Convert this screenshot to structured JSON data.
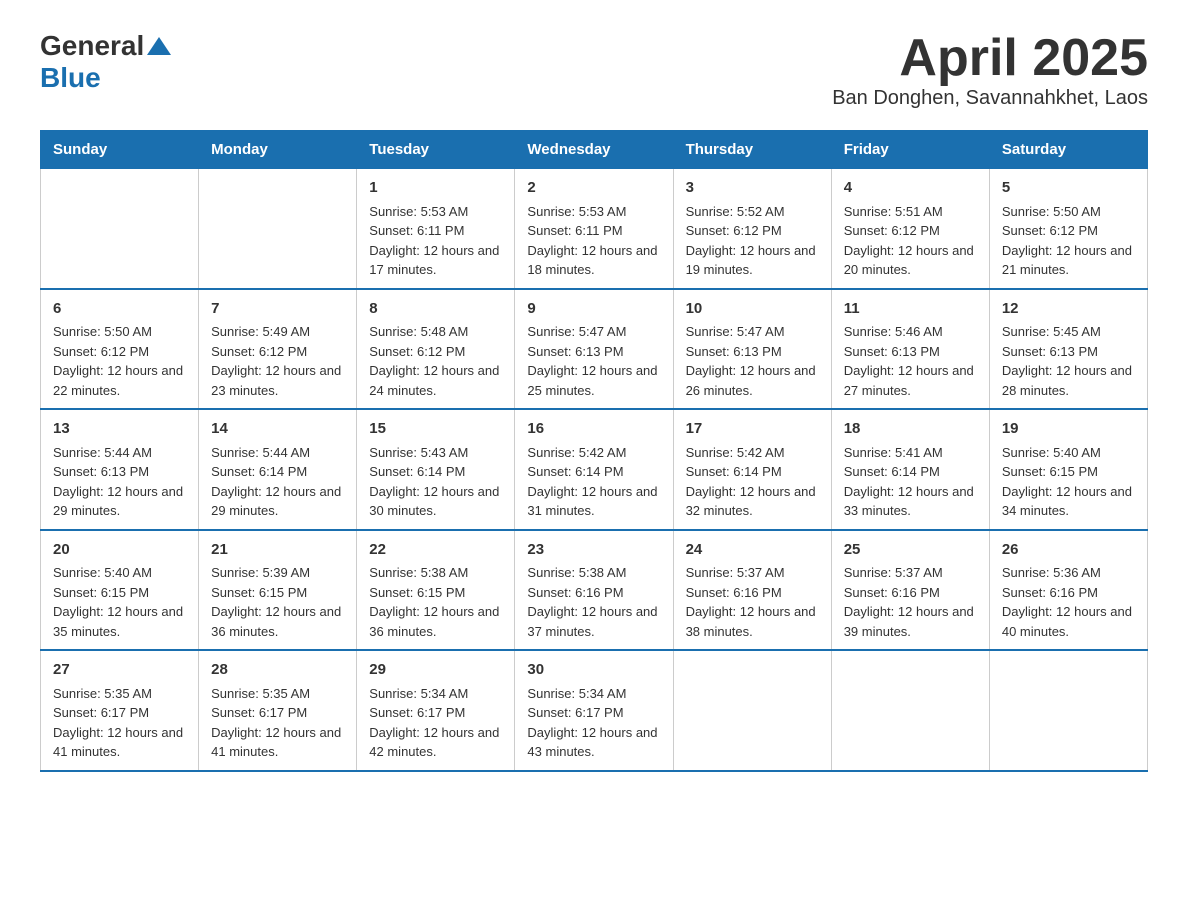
{
  "header": {
    "logo_general": "General",
    "logo_blue": "Blue",
    "title": "April 2025",
    "subtitle": "Ban Donghen, Savannahkhet, Laos"
  },
  "calendar": {
    "days_of_week": [
      "Sunday",
      "Monday",
      "Tuesday",
      "Wednesday",
      "Thursday",
      "Friday",
      "Saturday"
    ],
    "weeks": [
      [
        {
          "day": "",
          "info": ""
        },
        {
          "day": "",
          "info": ""
        },
        {
          "day": "1",
          "info": "Sunrise: 5:53 AM\nSunset: 6:11 PM\nDaylight: 12 hours and 17 minutes."
        },
        {
          "day": "2",
          "info": "Sunrise: 5:53 AM\nSunset: 6:11 PM\nDaylight: 12 hours and 18 minutes."
        },
        {
          "day": "3",
          "info": "Sunrise: 5:52 AM\nSunset: 6:12 PM\nDaylight: 12 hours and 19 minutes."
        },
        {
          "day": "4",
          "info": "Sunrise: 5:51 AM\nSunset: 6:12 PM\nDaylight: 12 hours and 20 minutes."
        },
        {
          "day": "5",
          "info": "Sunrise: 5:50 AM\nSunset: 6:12 PM\nDaylight: 12 hours and 21 minutes."
        }
      ],
      [
        {
          "day": "6",
          "info": "Sunrise: 5:50 AM\nSunset: 6:12 PM\nDaylight: 12 hours and 22 minutes."
        },
        {
          "day": "7",
          "info": "Sunrise: 5:49 AM\nSunset: 6:12 PM\nDaylight: 12 hours and 23 minutes."
        },
        {
          "day": "8",
          "info": "Sunrise: 5:48 AM\nSunset: 6:12 PM\nDaylight: 12 hours and 24 minutes."
        },
        {
          "day": "9",
          "info": "Sunrise: 5:47 AM\nSunset: 6:13 PM\nDaylight: 12 hours and 25 minutes."
        },
        {
          "day": "10",
          "info": "Sunrise: 5:47 AM\nSunset: 6:13 PM\nDaylight: 12 hours and 26 minutes."
        },
        {
          "day": "11",
          "info": "Sunrise: 5:46 AM\nSunset: 6:13 PM\nDaylight: 12 hours and 27 minutes."
        },
        {
          "day": "12",
          "info": "Sunrise: 5:45 AM\nSunset: 6:13 PM\nDaylight: 12 hours and 28 minutes."
        }
      ],
      [
        {
          "day": "13",
          "info": "Sunrise: 5:44 AM\nSunset: 6:13 PM\nDaylight: 12 hours and 29 minutes."
        },
        {
          "day": "14",
          "info": "Sunrise: 5:44 AM\nSunset: 6:14 PM\nDaylight: 12 hours and 29 minutes."
        },
        {
          "day": "15",
          "info": "Sunrise: 5:43 AM\nSunset: 6:14 PM\nDaylight: 12 hours and 30 minutes."
        },
        {
          "day": "16",
          "info": "Sunrise: 5:42 AM\nSunset: 6:14 PM\nDaylight: 12 hours and 31 minutes."
        },
        {
          "day": "17",
          "info": "Sunrise: 5:42 AM\nSunset: 6:14 PM\nDaylight: 12 hours and 32 minutes."
        },
        {
          "day": "18",
          "info": "Sunrise: 5:41 AM\nSunset: 6:14 PM\nDaylight: 12 hours and 33 minutes."
        },
        {
          "day": "19",
          "info": "Sunrise: 5:40 AM\nSunset: 6:15 PM\nDaylight: 12 hours and 34 minutes."
        }
      ],
      [
        {
          "day": "20",
          "info": "Sunrise: 5:40 AM\nSunset: 6:15 PM\nDaylight: 12 hours and 35 minutes."
        },
        {
          "day": "21",
          "info": "Sunrise: 5:39 AM\nSunset: 6:15 PM\nDaylight: 12 hours and 36 minutes."
        },
        {
          "day": "22",
          "info": "Sunrise: 5:38 AM\nSunset: 6:15 PM\nDaylight: 12 hours and 36 minutes."
        },
        {
          "day": "23",
          "info": "Sunrise: 5:38 AM\nSunset: 6:16 PM\nDaylight: 12 hours and 37 minutes."
        },
        {
          "day": "24",
          "info": "Sunrise: 5:37 AM\nSunset: 6:16 PM\nDaylight: 12 hours and 38 minutes."
        },
        {
          "day": "25",
          "info": "Sunrise: 5:37 AM\nSunset: 6:16 PM\nDaylight: 12 hours and 39 minutes."
        },
        {
          "day": "26",
          "info": "Sunrise: 5:36 AM\nSunset: 6:16 PM\nDaylight: 12 hours and 40 minutes."
        }
      ],
      [
        {
          "day": "27",
          "info": "Sunrise: 5:35 AM\nSunset: 6:17 PM\nDaylight: 12 hours and 41 minutes."
        },
        {
          "day": "28",
          "info": "Sunrise: 5:35 AM\nSunset: 6:17 PM\nDaylight: 12 hours and 41 minutes."
        },
        {
          "day": "29",
          "info": "Sunrise: 5:34 AM\nSunset: 6:17 PM\nDaylight: 12 hours and 42 minutes."
        },
        {
          "day": "30",
          "info": "Sunrise: 5:34 AM\nSunset: 6:17 PM\nDaylight: 12 hours and 43 minutes."
        },
        {
          "day": "",
          "info": ""
        },
        {
          "day": "",
          "info": ""
        },
        {
          "day": "",
          "info": ""
        }
      ]
    ]
  }
}
